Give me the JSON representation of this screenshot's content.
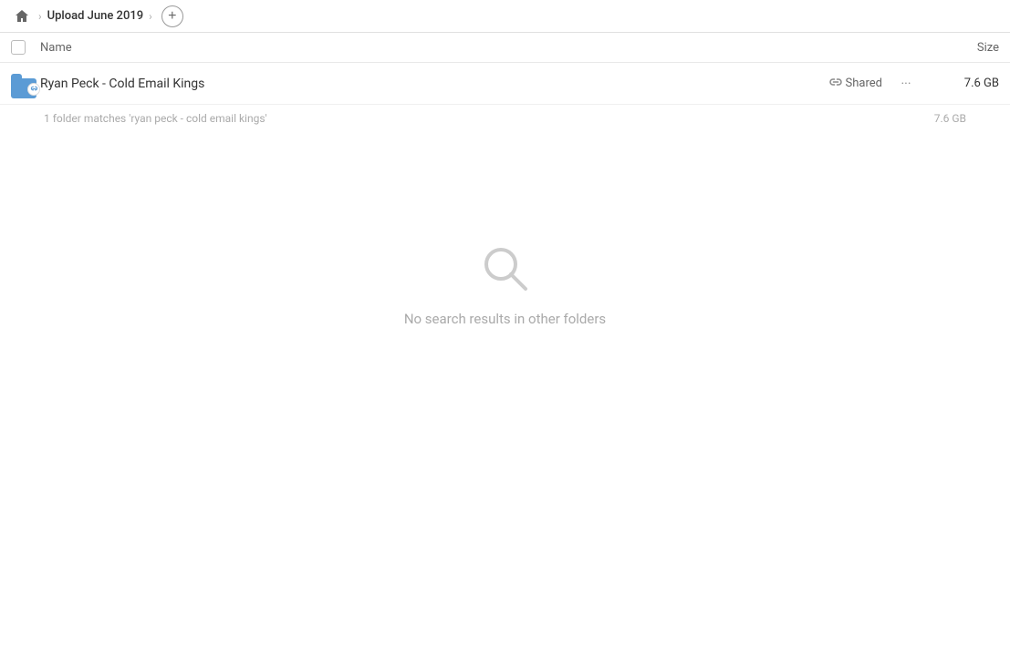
{
  "header": {
    "home_icon": "home",
    "breadcrumb": [
      {
        "label": "Upload June 2019"
      }
    ],
    "add_button_label": "+"
  },
  "table": {
    "col_name": "Name",
    "col_size": "Size"
  },
  "file_row": {
    "name": "Ryan Peck - Cold Email Kings",
    "shared_label": "Shared",
    "more_icon": "···",
    "size": "7.6 GB"
  },
  "match_info": {
    "text": "1 folder matches 'ryan peck - cold email kings'",
    "size": "7.6 GB"
  },
  "empty_state": {
    "message": "No search results in other folders"
  }
}
